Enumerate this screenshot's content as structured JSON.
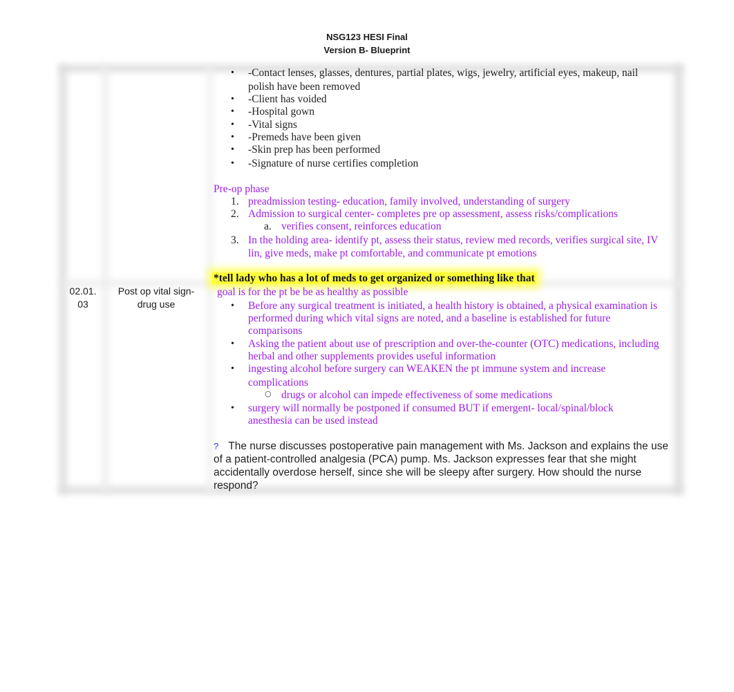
{
  "header": {
    "title": "NSG123 HESI Final",
    "subtitle": "Version B- Blueprint"
  },
  "row1": {
    "checklist": [
      "-Contact lenses, glasses, dentures, partial plates, wigs, jewelry, artificial eyes, makeup, nail",
      "polish have been removed",
      "-Client has voided",
      "-Hospital gown",
      "-Vital signs",
      "-Premeds have been given",
      "-Skin prep has been performed",
      "-Signature of nurse certifies completion"
    ],
    "preop_heading": "Pre-op phase",
    "preop_steps": [
      {
        "num": "1.",
        "text": "preadmission testing- education, family involved, understanding of surgery"
      },
      {
        "num": "2.",
        "text": "Admission to surgical center- completes pre op assessment, assess risks/complications"
      },
      {
        "num": "a.",
        "text": "verifies consent, reinforces education"
      },
      {
        "num": "3.",
        "text": "In the holding area- identify pt, assess their status, review med records, verifies surgical site, IV"
      },
      {
        "num": "",
        "text": "lin, give meds, make pt comfortable, and communicate pt emotions"
      }
    ],
    "highlight_note": "*tell lady who has a lot of meds to get organized or something like that"
  },
  "row2": {
    "code_line1": "02.01.",
    "code_line2": "03",
    "topic_line1": "Post op vital sign-",
    "topic_line2": "drug use",
    "goal": "goal is for the pt be be as healthy as possible",
    "lines": [
      "Before any surgical treatment is initiated, a health history is obtained, a physical examination is",
      "performed during which vital signs are noted, and a baseline is established for future",
      "comparisons",
      "Asking the patient about use of prescription and over-the-counter (OTC) medications, including",
      "herbal and other supplements provides useful information",
      "ingesting alcohol before surgery can WEAKEN the pt immune system and increase",
      "complications",
      "drugs or alcohol can impede effectiveness of some medications",
      "surgery will normally be postponed if consumed BUT if emergent- local/spinal/block",
      "anesthesia can be used instead"
    ],
    "question_mark": "?",
    "question": "The nurse discusses postoperative pain management with Ms. Jackson and explains the use of a patient-controlled analgesia (PCA) pump. Ms. Jackson expresses fear that she might accidentally overdose herself, since she will be sleepy after surgery. How should the nurse respond?"
  },
  "colors": {
    "note_purple": "#9b1fe8",
    "highlight_yellow": "#ffff3a",
    "question_mark_blue": "#2a3bd8"
  }
}
